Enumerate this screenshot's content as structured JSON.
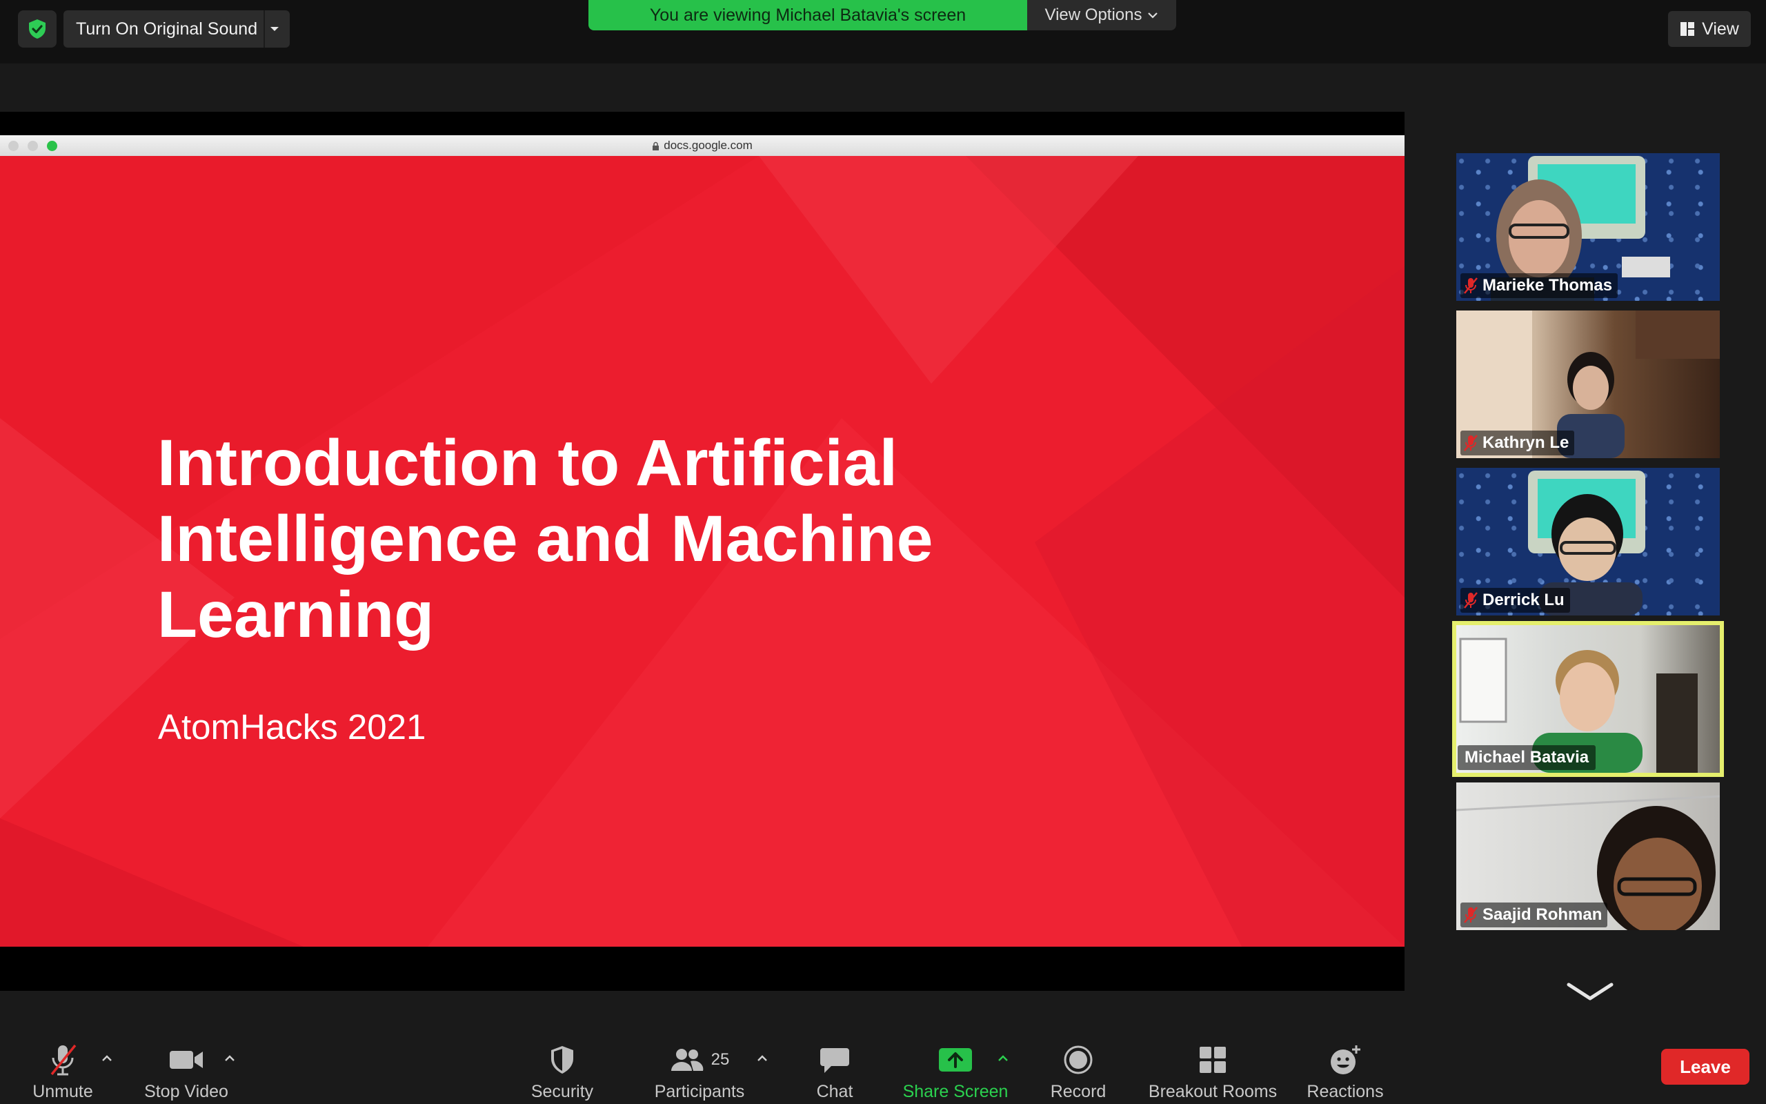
{
  "top_bar": {
    "original_sound_label": "Turn On Original Sound",
    "viewing_banner": "You are viewing Michael Batavia's screen",
    "view_options_label": "View Options",
    "view_label": "View"
  },
  "shared_screen": {
    "url": "docs.google.com",
    "slide_title": "Introduction to Artificial Intelligence and Machine Learning",
    "slide_subtitle": "AtomHacks 2021",
    "slide_color": "#ec1d2e"
  },
  "gallery": {
    "participants": [
      {
        "name": "Marieke Thomas",
        "muted": true
      },
      {
        "name": "Kathryn Le",
        "muted": true
      },
      {
        "name": "Derrick Lu",
        "muted": true
      },
      {
        "name": "Michael Batavia",
        "muted": false,
        "active_speaker": true
      },
      {
        "name": "Saajid Rohman",
        "muted": true
      }
    ]
  },
  "toolbar": {
    "unmute_label": "Unmute",
    "stop_video_label": "Stop Video",
    "security_label": "Security",
    "participants_label": "Participants",
    "participants_count": "25",
    "chat_label": "Chat",
    "share_screen_label": "Share Screen",
    "record_label": "Record",
    "breakout_rooms_label": "Breakout Rooms",
    "reactions_label": "Reactions",
    "leave_label": "Leave"
  },
  "colors": {
    "share_green": "#27c14a",
    "active_speaker_border": "#e5ef6d",
    "leave_red": "#e02828"
  }
}
